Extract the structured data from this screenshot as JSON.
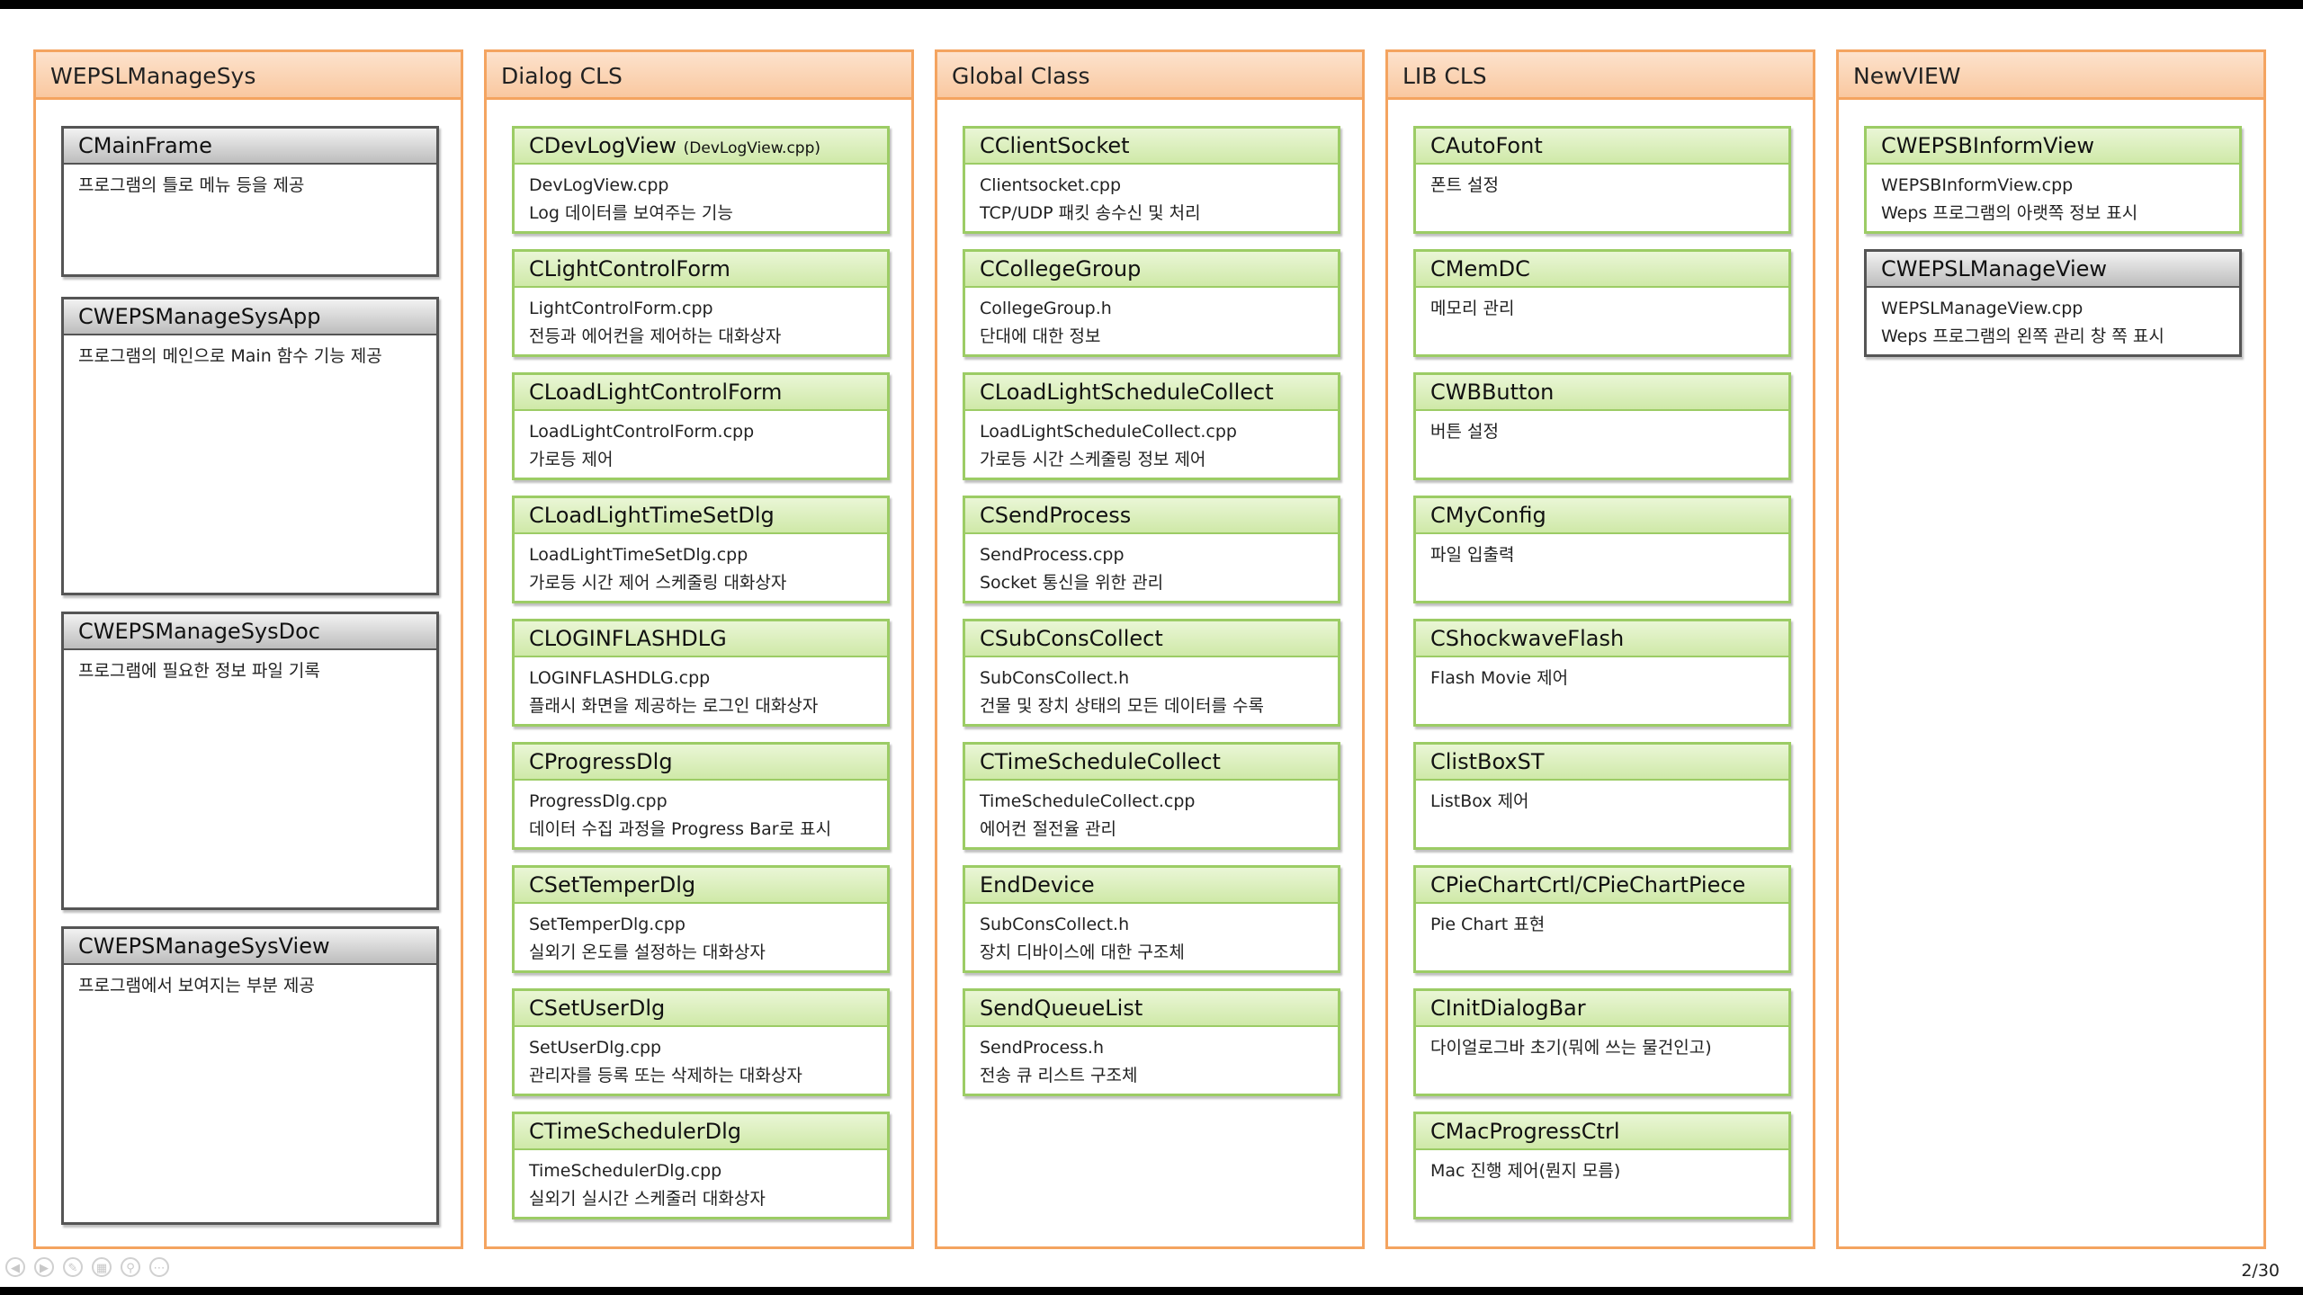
{
  "columns": [
    {
      "title": "WEPSLManageSys",
      "cards": [
        {
          "name": "CMainFrame",
          "lines": [
            "프로그램의 틀로 메뉴 등을 제공"
          ]
        },
        {
          "name": "CWEPSManageSysApp",
          "lines": [
            "프로그램의 메인으로 Main 함수 기능 제공"
          ]
        },
        {
          "name": "CWEPSManageSysDoc",
          "lines": [
            "프로그램에 필요한 정보 파일 기록"
          ]
        },
        {
          "name": "CWEPSManageSysView",
          "lines": [
            "프로그램에서 보여지는 부분 제공"
          ]
        }
      ]
    },
    {
      "title": "Dialog CLS",
      "cards": [
        {
          "name": "CDevLogView",
          "extra": "(DevLogView.cpp)",
          "lines": [
            "DevLogView.cpp",
            "Log 데이터를 보여주는 기능"
          ]
        },
        {
          "name": "CLightControlForm",
          "lines": [
            "LightControlForm.cpp",
            "전등과 에어컨을 제어하는 대화상자"
          ]
        },
        {
          "name": "CLoadLightControlForm",
          "lines": [
            "LoadLightControlForm.cpp",
            "가로등 제어"
          ]
        },
        {
          "name": "CLoadLightTimeSetDlg",
          "lines": [
            "LoadLightTimeSetDlg.cpp",
            "가로등 시간 제어 스케줄링 대화상자"
          ]
        },
        {
          "name": "CLOGINFLASHDLG",
          "lines": [
            "LOGINFLASHDLG.cpp",
            "플래시 화면을 제공하는 로그인 대화상자"
          ]
        },
        {
          "name": "CProgressDlg",
          "lines": [
            "ProgressDlg.cpp",
            "데이터 수집 과정을 Progress Bar로 표시"
          ]
        },
        {
          "name": "CSetTemperDlg",
          "lines": [
            "SetTemperDlg.cpp",
            "실외기 온도를 설정하는 대화상자"
          ]
        },
        {
          "name": "CSetUserDlg",
          "lines": [
            "SetUserDlg.cpp",
            "관리자를 등록 또는 삭제하는 대화상자"
          ]
        },
        {
          "name": "CTimeSchedulerDlg",
          "lines": [
            "TimeSchedulerDlg.cpp",
            "실외기 실시간 스케줄러 대화상자"
          ]
        }
      ]
    },
    {
      "title": "Global Class",
      "cards": [
        {
          "name": "CClientSocket",
          "lines": [
            "Clientsocket.cpp",
            "TCP/UDP 패킷 송수신 및 처리"
          ]
        },
        {
          "name": "CCollegeGroup",
          "lines": [
            "CollegeGroup.h",
            "단대에 대한 정보"
          ]
        },
        {
          "name": "CLoadLightScheduleCollect",
          "lines": [
            "LoadLightScheduleCollect.cpp",
            "가로등 시간 스케줄링 정보 제어"
          ]
        },
        {
          "name": "CSendProcess",
          "lines": [
            "SendProcess.cpp",
            "Socket 통신을 위한 관리"
          ]
        },
        {
          "name": "CSubConsCollect",
          "lines": [
            "SubConsCollect.h",
            "건물 및 장치 상태의 모든 데이터를 수록"
          ]
        },
        {
          "name": "CTimeScheduleCollect",
          "lines": [
            "TimeScheduleCollect.cpp",
            "에어컨 절전율 관리"
          ]
        },
        {
          "name": "EndDevice",
          "lines": [
            "SubConsCollect.h",
            "장치 디바이스에 대한 구조체"
          ]
        },
        {
          "name": "SendQueueList",
          "lines": [
            "SendProcess.h",
            "전송 큐 리스트 구조체"
          ]
        }
      ]
    },
    {
      "title": "LIB CLS",
      "cards": [
        {
          "name": "CAutoFont",
          "lines": [
            "폰트 설정"
          ]
        },
        {
          "name": "CMemDC",
          "lines": [
            "메모리 관리"
          ]
        },
        {
          "name": "CWBButton",
          "lines": [
            "버튼 설정"
          ]
        },
        {
          "name": "CMyConfig",
          "lines": [
            "파일 입출력"
          ]
        },
        {
          "name": "CShockwaveFlash",
          "lines": [
            "Flash Movie 제어"
          ]
        },
        {
          "name": "ClistBoxST",
          "lines": [
            "ListBox 제어"
          ]
        },
        {
          "name": "CPieChartCrtl/CPieChartPiece",
          "lines": [
            "Pie Chart 표현"
          ]
        },
        {
          "name": "CInitDialogBar",
          "lines": [
            "다이얼로그바 초기(뭐에 쓰는 물건인고)"
          ]
        },
        {
          "name": "CMacProgressCtrl",
          "lines": [
            "Mac 진행 제어(뭔지 모름)"
          ]
        }
      ]
    },
    {
      "title": "NewVIEW",
      "cards": [
        {
          "name": "CWEPSBInformView",
          "lines": [
            "WEPSBInformView.cpp",
            "Weps 프로그램의 아랫쪽 정보 표시"
          ]
        },
        {
          "name": "CWEPSLManageView",
          "lines": [
            "WEPSLManageView.cpp",
            "Weps 프로그램의 왼쪽 관리 창 쪽 표시"
          ]
        }
      ]
    }
  ],
  "footer": {
    "page": "2/30",
    "nav_icons": [
      "prev-arrow-icon",
      "next-arrow-icon",
      "pen-icon",
      "slides-icon",
      "zoom-icon",
      "more-icon"
    ]
  }
}
